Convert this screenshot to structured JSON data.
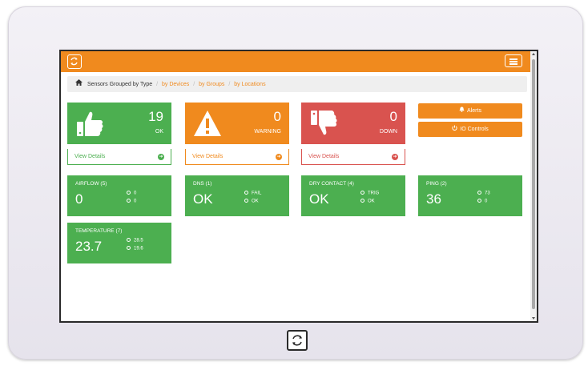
{
  "breadcrumb": {
    "current": "Sensors Grouped by Type",
    "links": [
      "by Devices",
      "by Groups",
      "by Locations"
    ]
  },
  "summary": {
    "ok": {
      "count": "19",
      "label": "OK",
      "details": "View Details"
    },
    "warning": {
      "count": "0",
      "label": "WARNING",
      "details": "View Details"
    },
    "down": {
      "count": "0",
      "label": "DOWN",
      "details": "View Details"
    }
  },
  "actions": {
    "alerts": "Alerts",
    "io_controls": "IO Controls"
  },
  "sensors": [
    {
      "title": "AIRFLOW (5)",
      "value": "0",
      "stat1": "0",
      "stat2": "0"
    },
    {
      "title": "DNS (1)",
      "value": "OK",
      "stat1": "FAIL",
      "stat2": "OK"
    },
    {
      "title": "DRY CONTACT (4)",
      "value": "OK",
      "stat1": "TRIG",
      "stat2": "OK"
    },
    {
      "title": "PING (2)",
      "value": "36",
      "stat1": "73",
      "stat2": "0"
    },
    {
      "title": "TEMPERATURE (7)",
      "value": "23.7",
      "stat1": "28.5",
      "stat2": "19.6"
    }
  ],
  "colors": {
    "accent": "#f08a1e",
    "ok": "#4caf50",
    "down": "#d9534f"
  },
  "icons": {
    "logo": "refresh-icon",
    "menu": "hamburger-menu-icon",
    "home": "home-icon",
    "ok": "thumbs-up-icon",
    "warning": "warning-triangle-icon",
    "down": "thumbs-down-icon",
    "alerts": "bell-icon",
    "io": "power-icon"
  }
}
